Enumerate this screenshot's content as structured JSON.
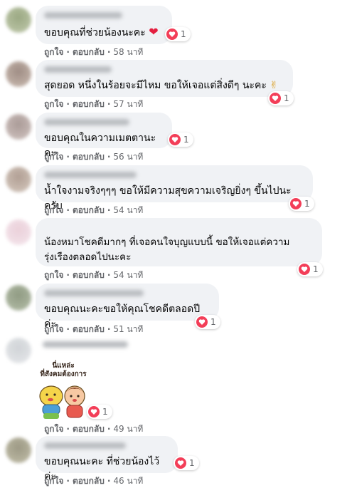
{
  "like_label": "ถูกใจ",
  "reply_label": "ตอบกลับ",
  "separator": "·",
  "colors": {
    "heart": "#f33e58",
    "bubble": "#f0f2f5",
    "meta": "#65676b"
  },
  "comments": [
    {
      "text": "ขอบคุณที่ช่วยน้องนะคะ",
      "inline_icon": "red-heart-emoji",
      "reaction_icon": "love-reaction-icon",
      "reaction_count": "1",
      "time": "58 นาที"
    },
    {
      "text": "สุดยอด หนึ่งในร้อยจะมีไหม ขอให้เจอแต่สิ่งดีๆ นะคะ",
      "inline_icon": "rock-on-hand-emoji",
      "reaction_icon": "love-reaction-icon",
      "reaction_count": "1",
      "time": "57 นาที"
    },
    {
      "text": "ขอบคุณในความเมตตานะคะ",
      "reaction_icon": "love-reaction-icon",
      "reaction_count": "1",
      "time": "56 นาที"
    },
    {
      "text": "น้ำใจงามจริงๆๆๆ ขอให้มีความสุขความเจริญยิ่งๆ ขึ้นไปนะครับ",
      "reaction_icon": "love-reaction-icon",
      "reaction_count": "1",
      "time": "54 นาที"
    },
    {
      "text": "น้องหมาโชคดีมากๆ ที่เจอคนใจบุญแบบนี้ ขอให้เจอแต่ความ\nรุ่งเรืองตลอดไปนะคะ",
      "reaction_icon": "love-reaction-icon",
      "reaction_count": "1",
      "time": "54 นาที"
    },
    {
      "text": "ขอบคุณนะคะขอให้คุณโชคดีตลอดปีค่ะ",
      "reaction_icon": "love-reaction-icon",
      "reaction_count": "1",
      "time": "51 นาที"
    },
    {
      "sticker_text": "นี่แหล่ะ\nที่สังคมต้องการ",
      "reaction_icon": "love-reaction-icon",
      "reaction_count": "1",
      "time": "49 นาที"
    },
    {
      "text": "ขอบคุณนะคะ ที่ช่วยน้องไว้ค่ะ",
      "reaction_icon": "love-reaction-icon",
      "reaction_count": "1",
      "time": "46 นาที"
    }
  ]
}
